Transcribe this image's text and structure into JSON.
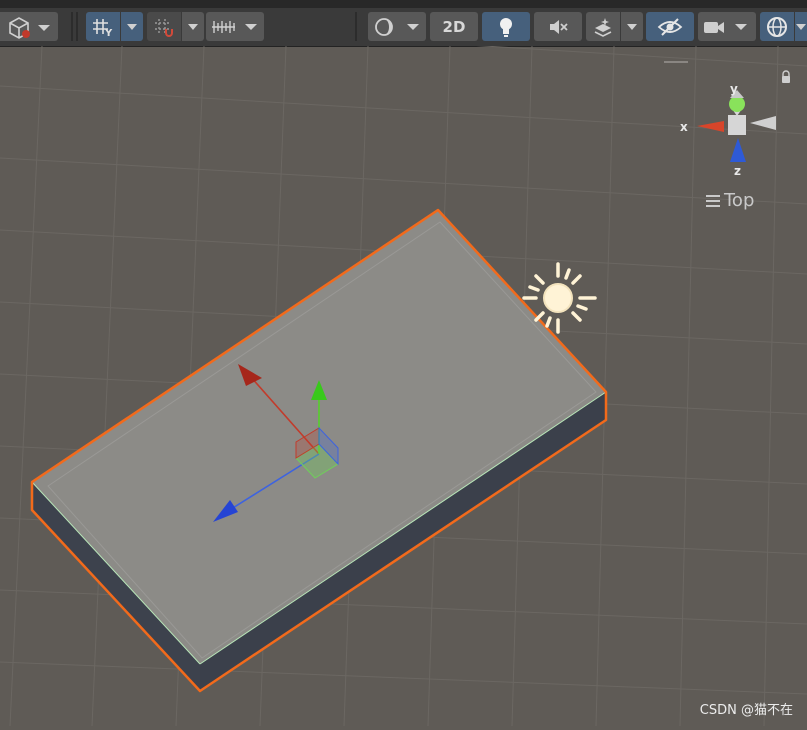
{
  "toolbar": {
    "two_d_label": "2D"
  },
  "gizmo": {
    "view_label": "Top",
    "axis_x": "x",
    "axis_y": "y",
    "axis_z": "z"
  },
  "watermark": "CSDN @猫不在",
  "colors": {
    "toolbar_bg": "#3a3a3a",
    "button_bg": "#585858",
    "button_active": "#46607c",
    "scene_bg": "#5f5b56",
    "selection_outline": "#f26a1b",
    "axis_x": "#d6351f",
    "axis_y": "#6fd03c",
    "axis_z": "#2a56d8"
  }
}
